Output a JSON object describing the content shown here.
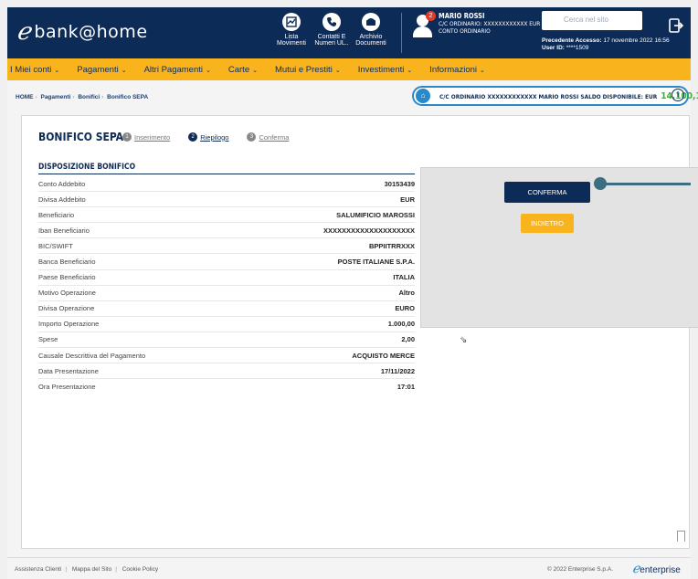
{
  "header": {
    "logo_text": "bank@home",
    "icons": [
      {
        "label": "Lista Movimenti",
        "icon": "chart-icon"
      },
      {
        "label": "Contatti E Numeri UL..",
        "icon": "phone-icon"
      },
      {
        "label": "Archivio Documenti",
        "icon": "archive-icon"
      }
    ],
    "user": {
      "name": "MARIO ROSSI",
      "account_line": "C/C ORDINARIO: XXXXXXXXXXXX EUR",
      "account_type": "CONTO ORDINARIO",
      "notifications": "2"
    },
    "search_placeholder": "Cerca nel sito",
    "last_access_label": "Precedente Accesso:",
    "last_access_value": "17 novembre 2022 16:56",
    "user_id_label": "User ID:",
    "user_id_value": "****1509"
  },
  "nav": [
    {
      "label": "I Miei conti"
    },
    {
      "label": "Pagamenti"
    },
    {
      "label": "Altri Pagamenti"
    },
    {
      "label": "Carte"
    },
    {
      "label": "Mutui e Prestiti"
    },
    {
      "label": "Investimenti"
    },
    {
      "label": "Informazioni"
    }
  ],
  "breadcrumb": [
    "HOME",
    "Pagamenti",
    "Bonifici",
    "Bonifico SEPA"
  ],
  "account_bar": {
    "text": "C/C ORDINARIO XXXXXXXXXXXX   MARIO ROSSI  SALDO DISPONIBILE: EUR",
    "amount": "14.100,14"
  },
  "page": {
    "title": "BONIFICO SEPA",
    "steps": [
      {
        "num": "1",
        "label": "Inserimento"
      },
      {
        "num": "2",
        "label": "Riepilogo"
      },
      {
        "num": "3",
        "label": "Conferma"
      }
    ],
    "section_title": "DISPOSIZIONE BONIFICO",
    "rows": [
      {
        "k": "Conto Addebito",
        "v": "30153439"
      },
      {
        "k": "Divisa Addebito",
        "v": "EUR"
      },
      {
        "k": "Beneficiario",
        "v": "SALUMIFICIO MAROSSI"
      },
      {
        "k": "Iban Beneficiario",
        "v": "XXXXXXXXXXXXXXXXXXXX"
      },
      {
        "k": "BIC/SWIFT",
        "v": "BPPIITRRXXX"
      },
      {
        "k": "Banca Beneficiario",
        "v": "POSTE ITALIANE S.P.A."
      },
      {
        "k": "Paese Beneficiario",
        "v": "ITALIA"
      },
      {
        "k": "Motivo Operazione",
        "v": "Altro"
      },
      {
        "k": "Divisa Operazione",
        "v": "EURO"
      },
      {
        "k": "Importo Operazione",
        "v": "1.000,00"
      },
      {
        "k": "Spese",
        "v": "2,00"
      },
      {
        "k": "Causale Descrittiva del Pagamento",
        "v": "ACQUISTO MERCE"
      },
      {
        "k": "Data Presentazione",
        "v": "17/11/2022"
      },
      {
        "k": "Ora Presentazione",
        "v": "17:01"
      }
    ],
    "confirm_label": "CONFERMA",
    "back_label": "INDIETRO"
  },
  "footer": {
    "links": [
      "Assistenza Clienti",
      "Mappa del Sito",
      "Cookie Policy"
    ],
    "copyright": "© 2022 Enterprise S.p.A.",
    "brand": "enterprise"
  }
}
